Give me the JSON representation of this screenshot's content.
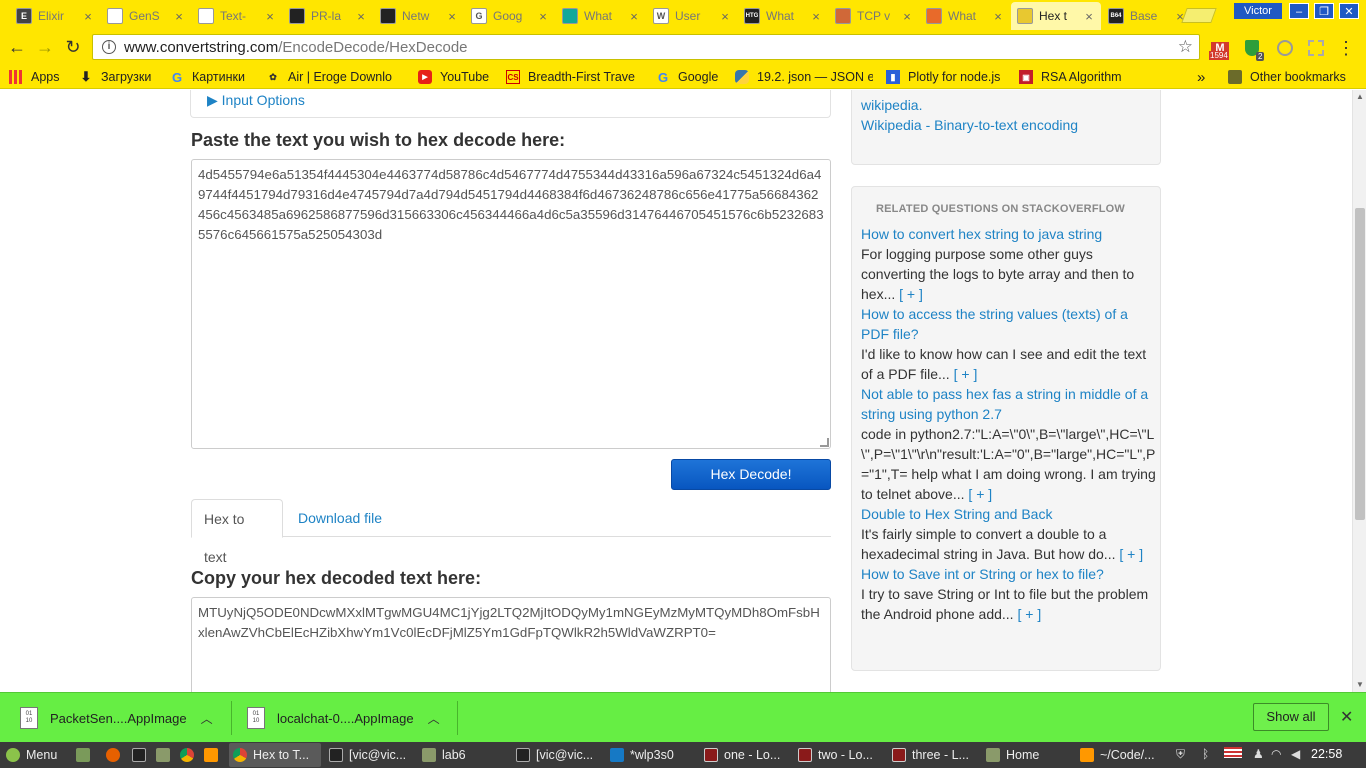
{
  "browser": {
    "tabs": [
      {
        "title": "Elixir",
        "icon": "elixir-icon",
        "color": "#444444",
        "glyph": "E"
      },
      {
        "title": "GenS",
        "icon": "doc-icon",
        "color": "#ffffff",
        "glyph": ""
      },
      {
        "title": "Text-",
        "icon": "doc-icon",
        "color": "#ffffff",
        "glyph": ""
      },
      {
        "title": "PR-la",
        "icon": "github-icon",
        "color": "#222222",
        "glyph": ""
      },
      {
        "title": "Netw",
        "icon": "github-icon",
        "color": "#222222",
        "glyph": ""
      },
      {
        "title": "Goog",
        "icon": "google-icon",
        "color": "#ffffff",
        "glyph": "G"
      },
      {
        "title": "What",
        "icon": "teal-square-icon",
        "color": "#12a89a",
        "glyph": ""
      },
      {
        "title": "User",
        "icon": "wikipedia-icon",
        "color": "#ffffff",
        "glyph": "W"
      },
      {
        "title": "What",
        "icon": "htg-icon",
        "color": "#222222",
        "glyph": "HTG"
      },
      {
        "title": "TCP v",
        "icon": "tcp-icon",
        "color": "#d06838",
        "glyph": ""
      },
      {
        "title": "What",
        "icon": "cloud-icon",
        "color": "#e86a2a",
        "glyph": ""
      },
      {
        "title": "Hex t",
        "icon": "convertstring-icon",
        "color": "#e8c830",
        "glyph": ""
      },
      {
        "title": "Base",
        "icon": "b64-icon",
        "color": "#222222",
        "glyph": "B64"
      }
    ],
    "active_tab_index": 11,
    "profile_name": "Victor",
    "window_controls": {
      "minimize": "–",
      "restore": "❐",
      "close": "✕"
    },
    "address": {
      "host": "www.convertstring.com",
      "path": "/EncodeDecode/HexDecode"
    },
    "extensions": [
      {
        "name": "gmail-icon",
        "badge": "1594"
      },
      {
        "name": "shield-extension-icon",
        "badge": "2"
      },
      {
        "name": "circle-extension-icon",
        "badge": ""
      },
      {
        "name": "grid-extension-icon",
        "badge": ""
      }
    ],
    "bookmarks": [
      {
        "label": "Apps",
        "icon": "apps-icon"
      },
      {
        "label": "Загрузки",
        "icon": "download-icon"
      },
      {
        "label": "Картинки",
        "icon": "google-icon"
      },
      {
        "label": "Air | Eroge Downlo",
        "icon": "bee-icon"
      },
      {
        "label": "YouTube",
        "icon": "youtube-icon"
      },
      {
        "label": "Breadth-First Trave",
        "icon": "cs-icon"
      },
      {
        "label": "Google",
        "icon": "google-icon"
      },
      {
        "label": "19.2. json — JSON e",
        "icon": "python-icon"
      },
      {
        "label": "Plotly for node.js",
        "icon": "plotly-icon"
      },
      {
        "label": "RSA Algorithm",
        "icon": "rsa-icon"
      }
    ],
    "bookmarks_overflow": "»",
    "other_bookmarks": "Other bookmarks"
  },
  "page": {
    "input_options_label": "▶ Input Options",
    "input_title": "Paste the text you wish to hex decode here:",
    "input_text": "4d5455794e6a51354f4445304e4463774d58786c4d5467774d4755344d43316a596a67324c5451324d6a49744f4451794d79316d4e4745794d7a4d794d5451794d4468384f6d46736248786c656e41775a56684362456c4563485a6962586877596d315663306c456344466a4d6c5a35596d31476446705451576c6b52326835576c645661575a525054303d",
    "decode_button": "Hex Decode!",
    "tabs": [
      "Hex to text",
      "Download file"
    ],
    "output_title": "Copy your hex decoded text here:",
    "output_text": "MTUyNjQ5ODE0NDcwMXxlMTgwMGU4MC1jYjg2LTQ2MjItODQyMy1mNGEyMzMyMTQyMDh8OmFsbHxlenAwZVhCbElEcHZibXhwYm1Vc0lEcDFjMlZ5Ym1GdFpTQWlkR2h5WldVaWZRPT0="
  },
  "sidebar": {
    "refs": [
      "wikipedia.",
      "Wikipedia - Binary-to-text encoding"
    ],
    "related_header": "RELATED QUESTIONS ON STACKOVERFLOW",
    "questions": [
      {
        "title": "How to convert hex string to java string",
        "excerpt": "For logging purpose some other guys converting the logs to byte array and then to hex...",
        "more": "[ + ]"
      },
      {
        "title": "How to access the string values (texts) of a PDF file?",
        "excerpt": "I'd like to know how can I see and edit the text of a PDF file...",
        "more": "[ + ]"
      },
      {
        "title": "Not able to pass hex fas a string in middle of a string using python 2.7",
        "excerpt": "code in python2.7:\"L:A=\\\"0\\\",B=\\\"large\\\",HC=\\\"L\\\",P=\\\"1\\\"\\r\\n\"result:'L:A=\"0\",B=\"large\",HC=\"L\",P=\"1\",T= help what I am doing wrong. I am trying to telnet above...",
        "more": "[ + ]"
      },
      {
        "title": "Double to Hex String and Back",
        "excerpt": "It's fairly simple to convert a double to a hexadecimal string in Java. But how do...",
        "more": "[ + ]"
      },
      {
        "title": "How to Save int or String or hex to file?",
        "excerpt": "I try to save String or Int to file but the problem the Android phone add...",
        "more": "[ + ]"
      }
    ]
  },
  "downloads": {
    "items": [
      {
        "name": "PacketSen....AppImage",
        "icon": "file-icon"
      },
      {
        "name": "localchat-0....AppImage",
        "icon": "file-icon"
      }
    ],
    "show_all": "Show all",
    "close": "✕"
  },
  "taskbar": {
    "menu_label": "Menu",
    "windows": [
      {
        "label": "Hex to T...",
        "icon": "chrome-icon",
        "active": true
      },
      {
        "label": "[vic@vic...",
        "icon": "terminal-icon",
        "active": false
      },
      {
        "label": "lab6",
        "icon": "folder-icon",
        "active": false
      },
      {
        "label": "[vic@vic...",
        "icon": "terminal-icon",
        "active": false
      },
      {
        "label": "*wlp3s0",
        "icon": "wireshark-icon",
        "active": false
      },
      {
        "label": "one - Lo...",
        "icon": "terminal-red-icon",
        "active": false
      },
      {
        "label": "two - Lo...",
        "icon": "terminal-red-icon",
        "active": false
      },
      {
        "label": "three - L...",
        "icon": "terminal-red-icon",
        "active": false
      },
      {
        "label": "Home",
        "icon": "folder-icon",
        "active": false
      },
      {
        "label": "~/Code/...",
        "icon": "sublime-icon",
        "active": false
      }
    ],
    "clock": "22:58"
  }
}
